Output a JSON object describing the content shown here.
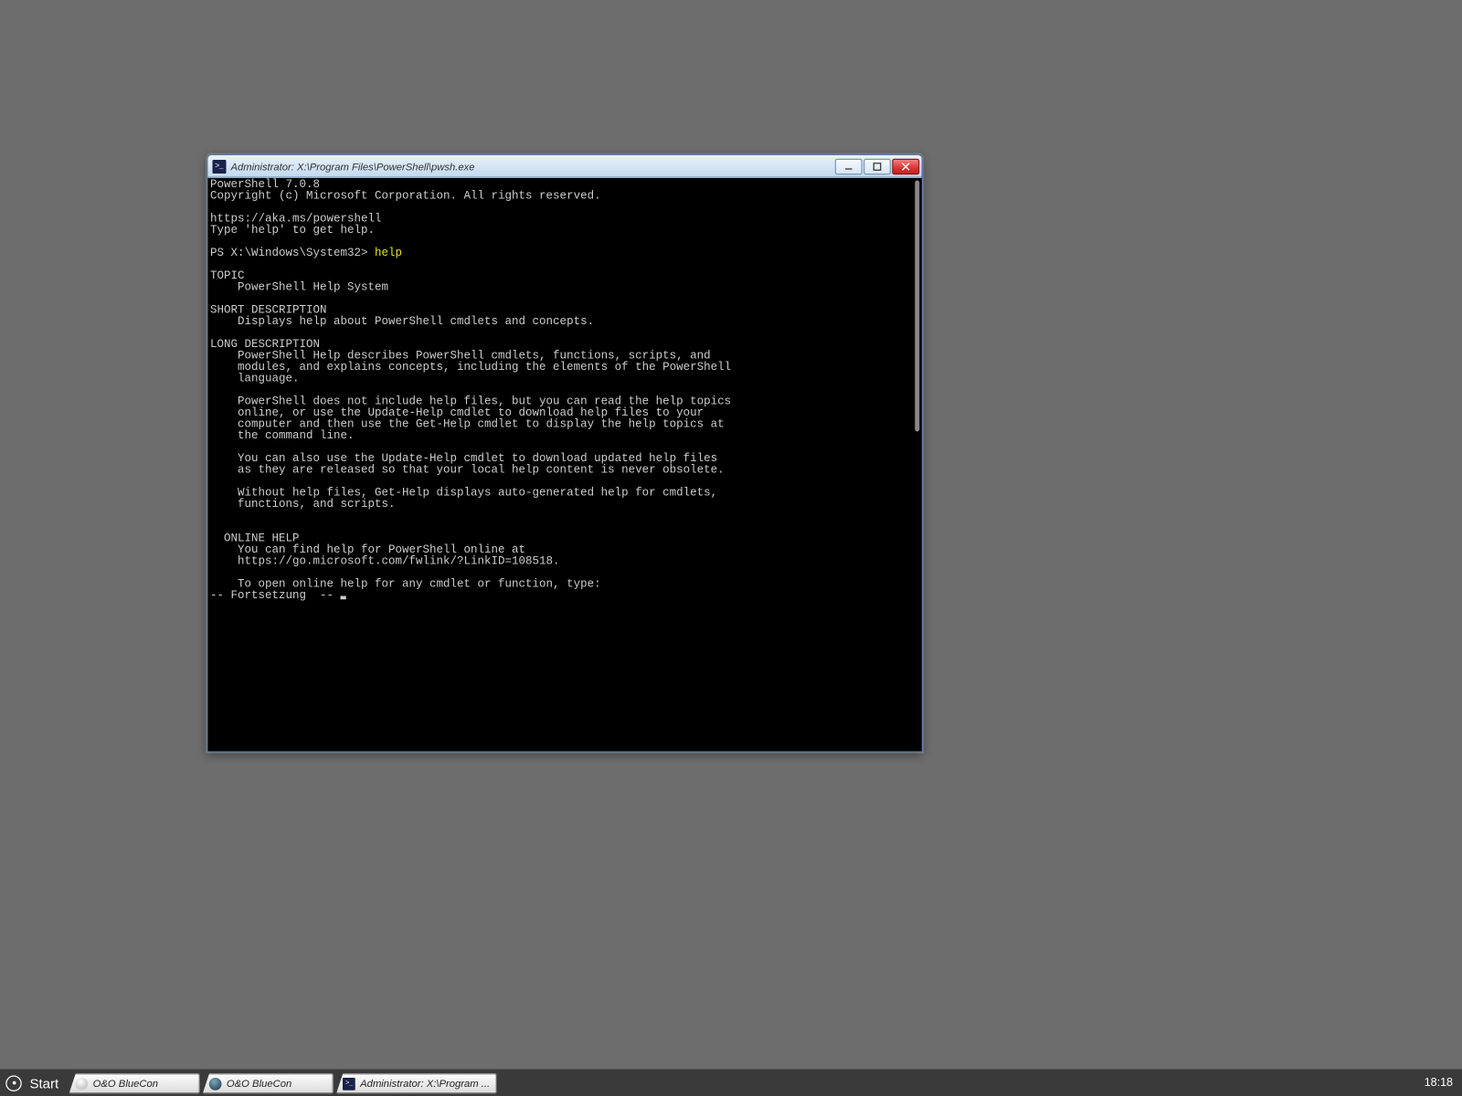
{
  "window": {
    "title": "Administrator: X:\\Program Files\\PowerShell\\pwsh.exe",
    "icon_label": ">_"
  },
  "terminal": {
    "header_line1": "PowerShell 7.0.8",
    "header_line2": "Copyright (c) Microsoft Corporation. All rights reserved.",
    "link_line": "https://aka.ms/powershell",
    "hint_line": "Type 'help' to get help.",
    "prompt_prefix": "PS X:\\Windows\\System32> ",
    "prompt_command": "help",
    "topic_header": "TOPIC",
    "topic_body": "    PowerShell Help System",
    "short_header": "SHORT DESCRIPTION",
    "short_body": "    Displays help about PowerShell cmdlets and concepts.",
    "long_header": "LONG DESCRIPTION",
    "long_p1_l1": "    PowerShell Help describes PowerShell cmdlets, functions, scripts, and",
    "long_p1_l2": "    modules, and explains concepts, including the elements of the PowerShell",
    "long_p1_l3": "    language.",
    "long_p2_l1": "    PowerShell does not include help files, but you can read the help topics",
    "long_p2_l2": "    online, or use the Update-Help cmdlet to download help files to your",
    "long_p2_l3": "    computer and then use the Get-Help cmdlet to display the help topics at",
    "long_p2_l4": "    the command line.",
    "long_p3_l1": "    You can also use the Update-Help cmdlet to download updated help files",
    "long_p3_l2": "    as they are released so that your local help content is never obsolete.",
    "long_p4_l1": "    Without help files, Get-Help displays auto-generated help for cmdlets,",
    "long_p4_l2": "    functions, and scripts.",
    "online_header": "  ONLINE HELP",
    "online_l1": "    You can find help for PowerShell online at",
    "online_l2": "    https://go.microsoft.com/fwlink/?LinkID=108518.",
    "online_l3": "    To open online help for any cmdlet or function, type:",
    "continuation": "-- Fortsetzung  -- "
  },
  "taskbar": {
    "start": "Start",
    "items": [
      {
        "label": "O&O BlueCon"
      },
      {
        "label": "O&O BlueCon"
      },
      {
        "label": "Administrator: X:\\Program ..."
      }
    ],
    "clock": "18:18"
  }
}
